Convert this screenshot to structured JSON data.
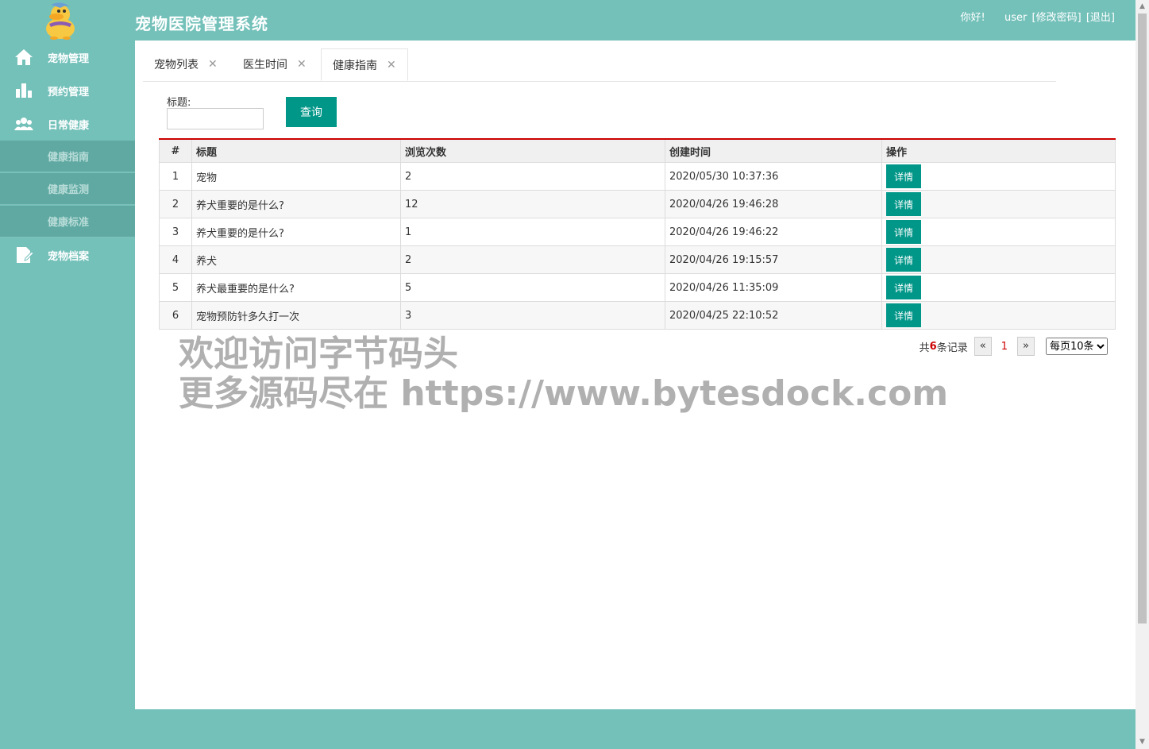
{
  "header": {
    "title": "宠物医院管理系统",
    "greeting": "你好!",
    "username": "user",
    "change_password": "[修改密码]",
    "logout": "[退出]"
  },
  "sidebar": {
    "items": [
      {
        "label": "宠物管理",
        "icon": "home-icon"
      },
      {
        "label": "预约管理",
        "icon": "bar-chart-icon"
      },
      {
        "label": "日常健康",
        "icon": "users-icon"
      },
      {
        "label": "宠物档案",
        "icon": "document-icon"
      }
    ],
    "subitems": [
      {
        "label": "健康指南"
      },
      {
        "label": "健康监测"
      },
      {
        "label": "健康标准"
      }
    ]
  },
  "tabs": [
    {
      "label": "宠物列表",
      "active": false
    },
    {
      "label": "医生时间",
      "active": false
    },
    {
      "label": "健康指南",
      "active": true
    }
  ],
  "search": {
    "label": "标题:",
    "value": "",
    "button": "查询"
  },
  "table": {
    "headers": [
      "#",
      "标题",
      "浏览次数",
      "创建时间",
      "操作"
    ],
    "rows": [
      {
        "num": "1",
        "title": "宠物",
        "views": "2",
        "created": "2020/05/30 10:37:36",
        "action": "详情"
      },
      {
        "num": "2",
        "title": "养犬重要的是什么?",
        "views": "12",
        "created": "2020/04/26 19:46:28",
        "action": "详情"
      },
      {
        "num": "3",
        "title": "养犬重要的是什么?",
        "views": "1",
        "created": "2020/04/26 19:46:22",
        "action": "详情"
      },
      {
        "num": "4",
        "title": "养犬",
        "views": "2",
        "created": "2020/04/26 19:15:57",
        "action": "详情"
      },
      {
        "num": "5",
        "title": "养犬最重要的是什么?",
        "views": "5",
        "created": "2020/04/26 11:35:09",
        "action": "详情"
      },
      {
        "num": "6",
        "title": "宠物预防针多久打一次",
        "views": "3",
        "created": "2020/04/25 22:10:52",
        "action": "详情"
      }
    ]
  },
  "pager": {
    "total_prefix": "共",
    "total": "6",
    "total_suffix": "条记录",
    "prev": "«",
    "page": "1",
    "next": "»",
    "page_size": "每页10条"
  },
  "watermark": {
    "line1": "欢迎访问字节码头",
    "line2": "更多源码尽在 https://www.bytesdock.com"
  },
  "colors": {
    "theme": "#74c1ba",
    "button": "#009688",
    "accent": "#cc0000"
  }
}
